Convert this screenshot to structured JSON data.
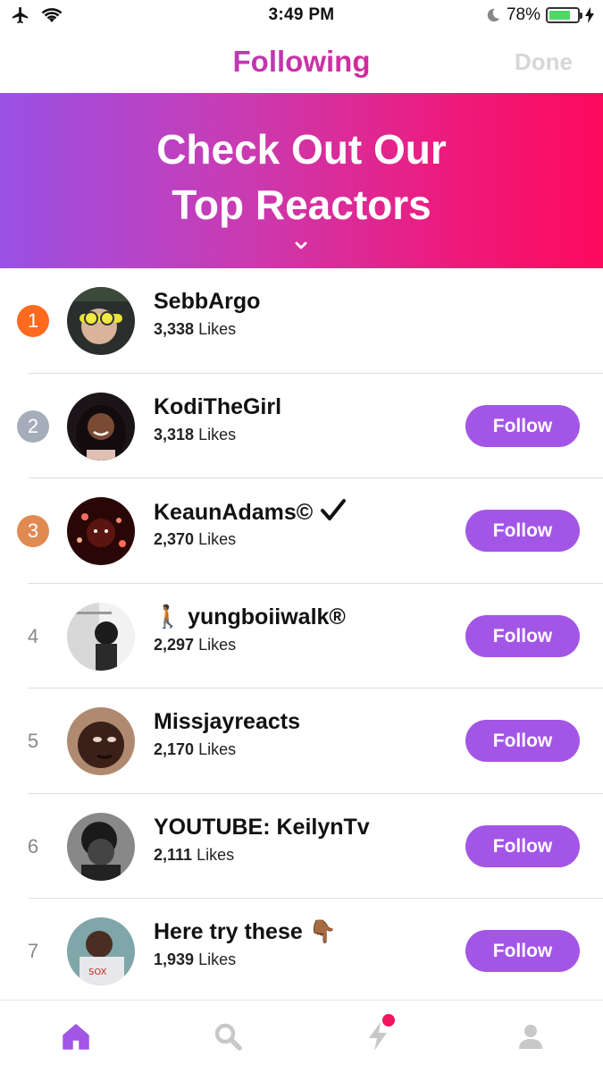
{
  "status_bar": {
    "time": "3:49 PM",
    "battery": "78%",
    "battery_level": 0.78
  },
  "nav": {
    "title": "Following",
    "done_label": "Done"
  },
  "banner": {
    "line1": "Check Out Our",
    "line2": "Top Reactors"
  },
  "follow_label": "Follow",
  "likes_suffix": "Likes",
  "users": [
    {
      "rank": "1",
      "name": "SebbArgo",
      "likes": "3,338",
      "has_follow": false,
      "badge_color": "#ff6a1f"
    },
    {
      "rank": "2",
      "name": "KodiTheGirl",
      "likes": "3,318",
      "has_follow": true,
      "badge_color": "#a6adba"
    },
    {
      "rank": "3",
      "name": "KeaunAdams©",
      "likes": "2,370",
      "has_follow": true,
      "badge_color": "#e08a52",
      "verified": true
    },
    {
      "rank": "4",
      "name": "🚶🏾 yungboiiwalk®",
      "likes": "2,297",
      "has_follow": true
    },
    {
      "rank": "5",
      "name": "Missjayreacts",
      "likes": "2,170",
      "has_follow": true
    },
    {
      "rank": "6",
      "name": "YOUTUBE: KeilynTv",
      "likes": "2,111",
      "has_follow": true
    },
    {
      "rank": "7",
      "name": "Here try these 👇🏾",
      "likes": "1,939",
      "has_follow": true
    }
  ],
  "tabbar": {
    "items": [
      "home-icon",
      "search-icon",
      "lightning-icon",
      "profile-icon"
    ],
    "active": "home-icon",
    "accent": "#a356e6"
  }
}
